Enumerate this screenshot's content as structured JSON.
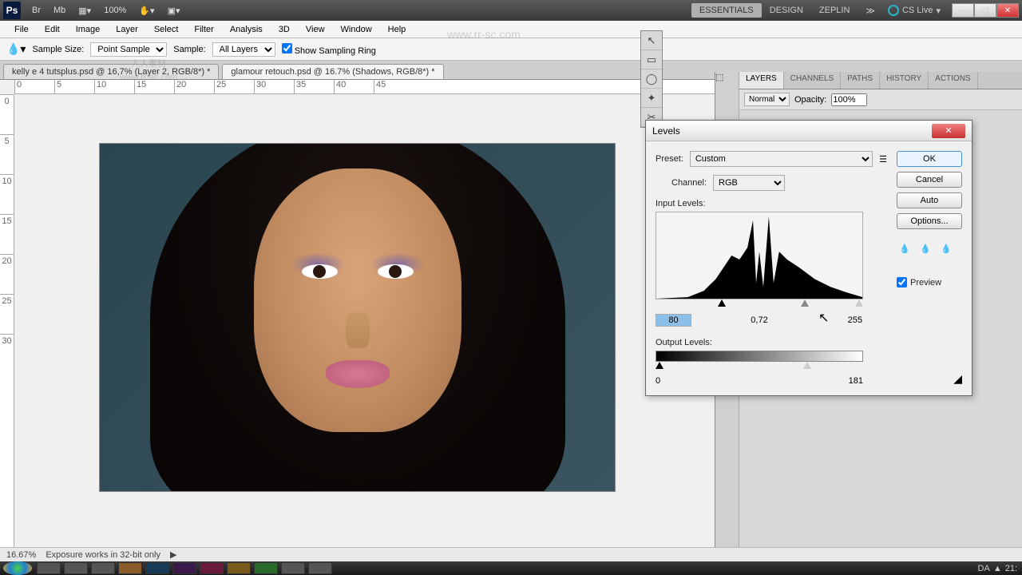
{
  "topbar": {
    "logo": "Ps",
    "zoom": "100%",
    "workspaces": [
      "ESSENTIALS",
      "DESIGN",
      "ZEPLIN"
    ],
    "cslive": "CS Live"
  },
  "menu": [
    "File",
    "Edit",
    "Image",
    "Layer",
    "Select",
    "Filter",
    "Analysis",
    "3D",
    "View",
    "Window",
    "Help"
  ],
  "options": {
    "sample_size_label": "Sample Size:",
    "sample_size": "Point Sample",
    "sample_label": "Sample:",
    "sample": "All Layers",
    "show_ring": "Show Sampling Ring"
  },
  "tabs": [
    "kelly e 4 tutsplus.psd @ 16,7% (Layer 2, RGB/8*) *",
    "glamour retouch.psd @ 16.7% (Shadows, RGB/8*) *"
  ],
  "ruler_h": [
    "0",
    "5",
    "10",
    "15",
    "20",
    "25",
    "30",
    "35",
    "40",
    "45"
  ],
  "ruler_v": [
    "0",
    "5",
    "10",
    "15",
    "20",
    "25",
    "30"
  ],
  "panels": {
    "tabs": [
      "LAYERS",
      "CHANNELS",
      "PATHS",
      "HISTORY",
      "ACTIONS"
    ],
    "blend": "Normal",
    "opacity_label": "Opacity:",
    "opacity": "100%"
  },
  "dialog": {
    "title": "Levels",
    "preset_label": "Preset:",
    "preset": "Custom",
    "channel_label": "Channel:",
    "channel": "RGB",
    "input_label": "Input Levels:",
    "input_black": "80",
    "input_gamma": "0,72",
    "input_white": "255",
    "output_label": "Output Levels:",
    "output_black": "0",
    "output_white": "181",
    "ok": "OK",
    "cancel": "Cancel",
    "auto": "Auto",
    "options": "Options...",
    "preview": "Preview"
  },
  "status": {
    "zoom": "16.67%",
    "doc": "Exposure works in 32-bit only"
  },
  "taskbar": {
    "lang": "DA",
    "time": "21:"
  },
  "watermark": {
    "url": "www.rr-sc.com",
    "text": "人人素材"
  }
}
